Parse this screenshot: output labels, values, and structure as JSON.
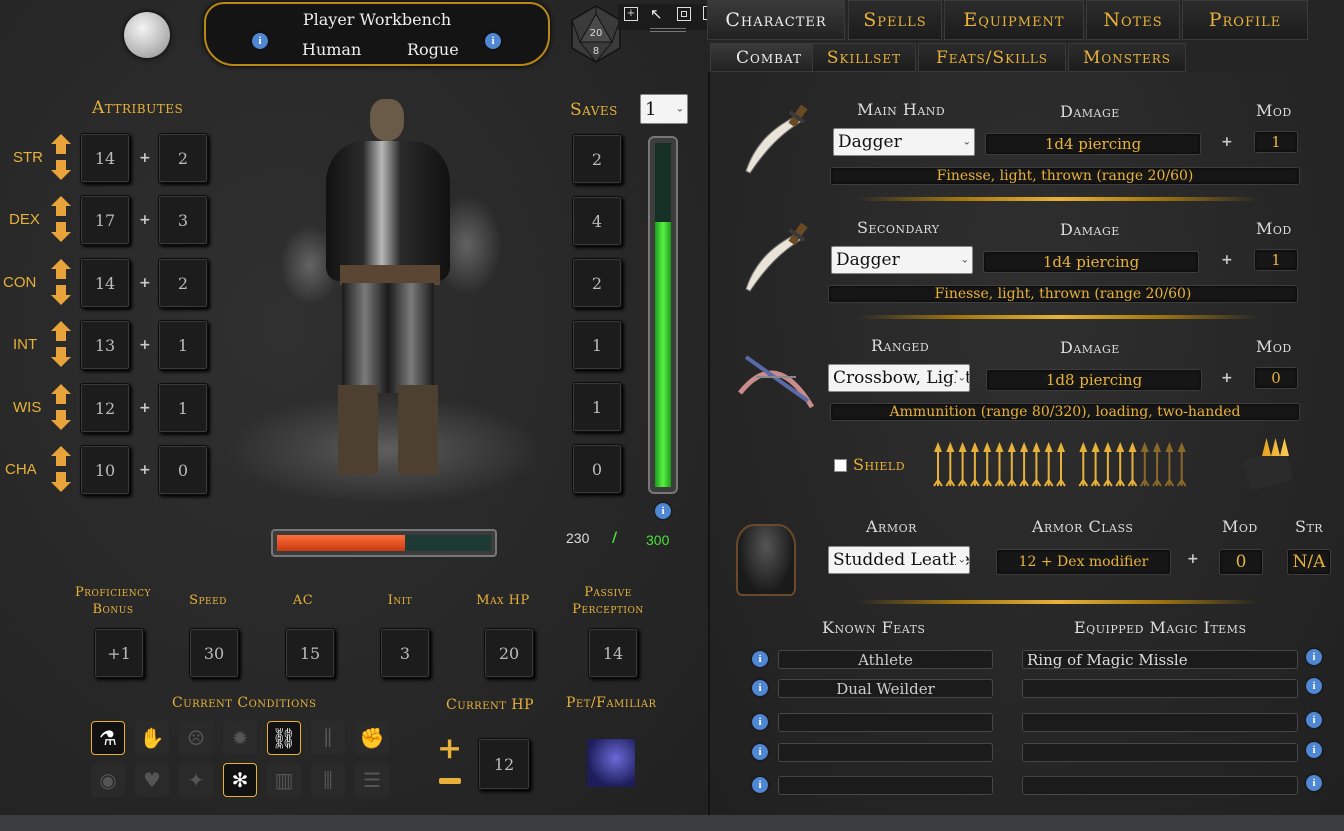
{
  "header": {
    "title": "Player Workbench",
    "race": "Human",
    "class": "Rogue",
    "d20_top": "20",
    "d20_bottom": "8"
  },
  "top_tabs": [
    {
      "label": "Character",
      "active": true
    },
    {
      "label": "Spells",
      "active": false
    },
    {
      "label": "Equipment",
      "active": false
    },
    {
      "label": "Notes",
      "active": false
    },
    {
      "label": "Profile",
      "active": false
    }
  ],
  "sub_tabs": [
    {
      "label": "Combat",
      "active": true
    },
    {
      "label": "Skillset",
      "active": false
    },
    {
      "label": "Feats/Skills",
      "active": false
    },
    {
      "label": "Monsters",
      "active": false
    }
  ],
  "attributes": {
    "title": "Attributes",
    "items": [
      {
        "name": "STR",
        "score": "14",
        "mod": "2"
      },
      {
        "name": "DEX",
        "score": "17",
        "mod": "3"
      },
      {
        "name": "CON",
        "score": "14",
        "mod": "2"
      },
      {
        "name": "INT",
        "score": "13",
        "mod": "1"
      },
      {
        "name": "WIS",
        "score": "12",
        "mod": "1"
      },
      {
        "name": "CHA",
        "score": "10",
        "mod": "0"
      }
    ]
  },
  "saves": {
    "title": "Saves",
    "values": [
      "2",
      "4",
      "2",
      "1",
      "1",
      "0"
    ],
    "level_select": "1"
  },
  "xp": {
    "current": "230",
    "sep": "/",
    "max": "300",
    "fill_fraction": 0.77
  },
  "hp_bar": {
    "fill_fraction": 0.6
  },
  "stats": [
    {
      "label": "Proficiency Bonus",
      "value": "+1"
    },
    {
      "label": "Speed",
      "value": "30"
    },
    {
      "label": "AC",
      "value": "15"
    },
    {
      "label": "Init",
      "value": "3"
    },
    {
      "label": "Max HP",
      "value": "20"
    },
    {
      "label": "Passive Perception",
      "value": "14"
    }
  ],
  "conditions": {
    "title": "Current Conditions",
    "icons": [
      {
        "name": "poisoned",
        "active": true
      },
      {
        "name": "grappled",
        "active": false
      },
      {
        "name": "frightened",
        "active": false
      },
      {
        "name": "exhausted",
        "active": false
      },
      {
        "name": "restrained",
        "active": true
      },
      {
        "name": "incapacitated",
        "active": false
      },
      {
        "name": "deafened",
        "active": false
      },
      {
        "name": "blinded",
        "active": false
      },
      {
        "name": "charmed",
        "active": false
      },
      {
        "name": "stunned",
        "active": false
      },
      {
        "name": "paralyzed",
        "active": true
      },
      {
        "name": "petrified",
        "active": false
      },
      {
        "name": "prone",
        "active": false
      },
      {
        "name": "unconscious",
        "active": false
      }
    ]
  },
  "current_hp": {
    "title": "Current HP",
    "value": "12"
  },
  "pet": {
    "title": "Pet/Familiar"
  },
  "weapons": [
    {
      "slot": "Main Hand",
      "weapon": "Dagger",
      "damage_label": "Damage",
      "damage": "1d4 piercing",
      "mod_label": "Mod",
      "mod": "1",
      "props": "Finesse, light, thrown (range 20/60)"
    },
    {
      "slot": "Secondary",
      "weapon": "Dagger",
      "damage_label": "Damage",
      "damage": "1d4 piercing",
      "mod_label": "Mod",
      "mod": "1",
      "props": "Finesse, light, thrown (range 20/60)"
    },
    {
      "slot": "Ranged",
      "weapon": "Crossbow, Light",
      "damage_label": "Damage",
      "damage": "1d8 piercing",
      "mod_label": "Mod",
      "mod": "0",
      "props": "Ammunition (range 80/320), loading, two-handed"
    }
  ],
  "shield": {
    "label": "Shield",
    "checked": false
  },
  "ammo": {
    "total": 20,
    "remaining": 16
  },
  "armor": {
    "label": "Armor",
    "value": "Studded Leather",
    "ac_label": "Armor Class",
    "ac": "12 + Dex modifier",
    "mod_label": "Mod",
    "mod": "0",
    "str_label": "Str",
    "str": "N/A"
  },
  "feats": {
    "title": "Known Feats",
    "items": [
      "Athlete",
      "Dual Weilder",
      "",
      "",
      ""
    ]
  },
  "magic_items": {
    "title": "Equipped Magic Items",
    "items": [
      "Ring of Magic Missle",
      "",
      "",
      "",
      ""
    ]
  },
  "colors": {
    "accent": "#e8b23a",
    "xp_bar": "#3fdc2f",
    "hp_bar": "#e0451a",
    "info": "#4f87d2"
  }
}
